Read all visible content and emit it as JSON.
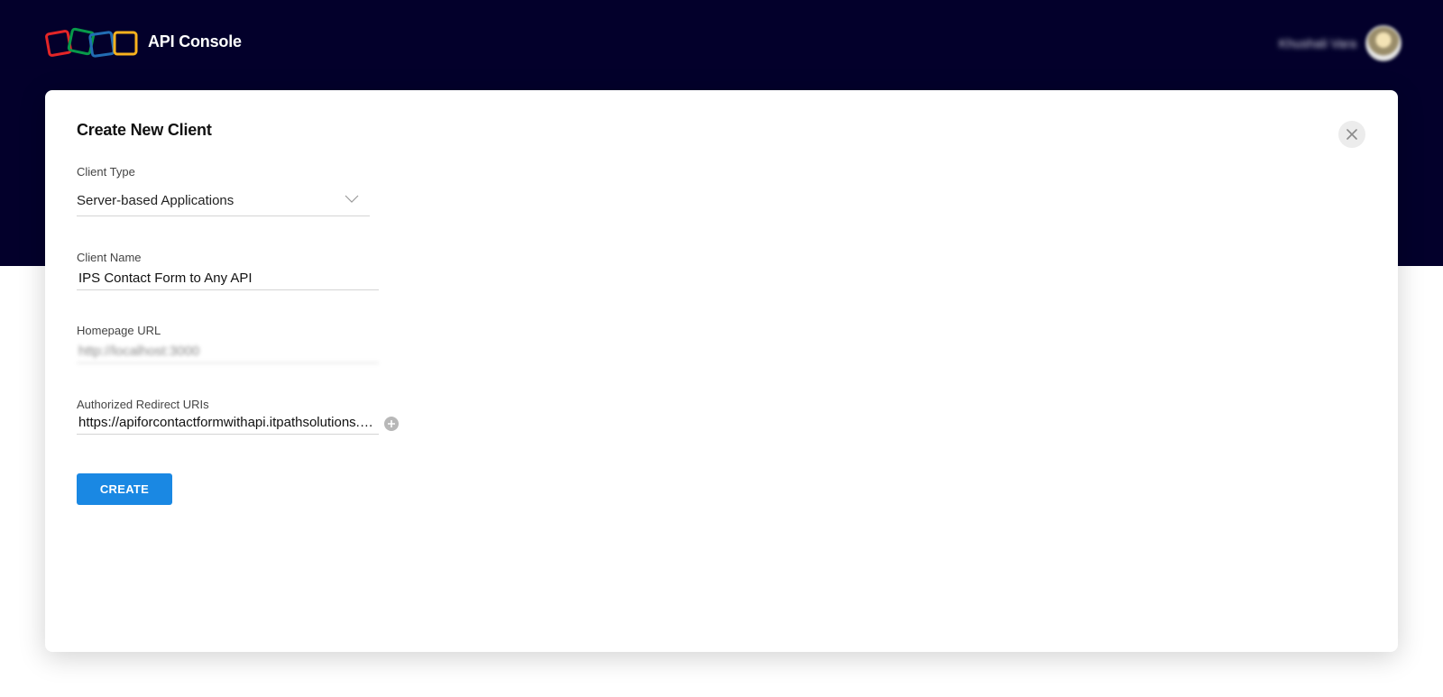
{
  "header": {
    "app_title": "API Console",
    "user_name": "Khushali Vara"
  },
  "colors": {
    "header_bg": "#03002b",
    "primary_button": "#1a88e3",
    "logo_red": "#e42527",
    "logo_green": "#089949",
    "logo_blue": "#226db4",
    "logo_yellow": "#f9b21d"
  },
  "modal": {
    "title": "Create New Client",
    "close_icon": "close-icon",
    "client_type": {
      "label": "Client Type",
      "value": "Server-based Applications"
    },
    "client_name": {
      "label": "Client Name",
      "value": "IPS Contact Form to Any API"
    },
    "homepage_url": {
      "label": "Homepage URL",
      "value": "http://localhost:3000"
    },
    "redirect_uris": {
      "label": "Authorized Redirect URIs",
      "value": "https://apiforcontactformwithapi.itpathsolutions.com"
    },
    "create_label": "CREATE"
  }
}
